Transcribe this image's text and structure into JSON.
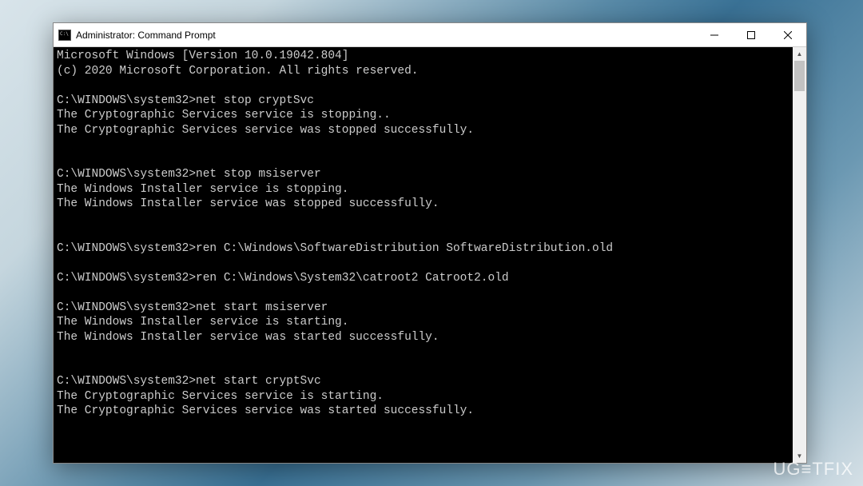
{
  "window": {
    "title": "Administrator: Command Prompt"
  },
  "console": {
    "header1": "Microsoft Windows [Version 10.0.19042.804]",
    "header2": "(c) 2020 Microsoft Corporation. All rights reserved.",
    "prompt": "C:\\WINDOWS\\system32>",
    "blocks": [
      {
        "cmd": "net stop cryptSvc",
        "out": [
          "The Cryptographic Services service is stopping..",
          "The Cryptographic Services service was stopped successfully."
        ]
      },
      {
        "cmd": "net stop msiserver",
        "out": [
          "The Windows Installer service is stopping.",
          "The Windows Installer service was stopped successfully."
        ]
      },
      {
        "cmd": "ren C:\\Windows\\SoftwareDistribution SoftwareDistribution.old",
        "out": []
      },
      {
        "cmd": "ren C:\\Windows\\System32\\catroot2 Catroot2.old",
        "out": []
      },
      {
        "cmd": "net start msiserver",
        "out": [
          "The Windows Installer service is starting.",
          "The Windows Installer service was started successfully."
        ]
      },
      {
        "cmd": "net start cryptSvc",
        "out": [
          "The Cryptographic Services service is starting.",
          "The Cryptographic Services service was started successfully."
        ]
      }
    ]
  },
  "watermark": "UG≡TFIX"
}
